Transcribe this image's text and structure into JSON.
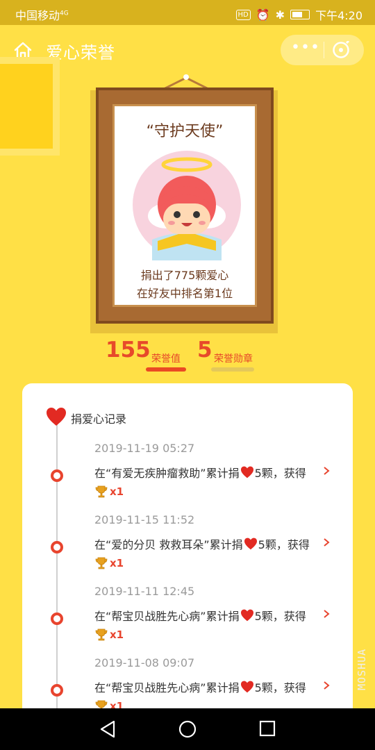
{
  "statusbar": {
    "carrier": "中国移动",
    "network": "4G",
    "hd": "HD",
    "time": "下午4:20"
  },
  "header": {
    "title": "爱心荣誉",
    "more_label": "•••"
  },
  "honor": {
    "title": "“守护天使”",
    "line1": "捐出了775颗爱心",
    "line2": "在好友中排名第1位"
  },
  "stats": {
    "honor_value": "155",
    "honor_label": "荣誉值",
    "medal_value": "5",
    "medal_label": "荣誉勋章"
  },
  "records": {
    "title": "捐爱心记录",
    "items": [
      {
        "date": "2019-11-19 05:27",
        "prefix": "在“有爱无疾肿瘤救助”累计捐",
        "suffix": "5颗，获得",
        "reward": "x1"
      },
      {
        "date": "2019-11-15 11:52",
        "prefix": "在“爱的分贝 救救耳朵”累计捐",
        "suffix": "5颗，获得",
        "reward": "x1"
      },
      {
        "date": "2019-11-11 12:45",
        "prefix": "在“帮宝贝战胜先心病”累计捐",
        "suffix": "5颗，获得",
        "reward": "x1"
      },
      {
        "date": "2019-11-08 09:07",
        "prefix": "在“帮宝贝战胜先心病”累计捐",
        "suffix": "5颗，获得",
        "reward": "x1"
      }
    ]
  },
  "watermark": "MOSHUA",
  "colors": {
    "background": "#ffe046",
    "accent_red": "#e7492a",
    "frame_brown": "#a86a32"
  }
}
